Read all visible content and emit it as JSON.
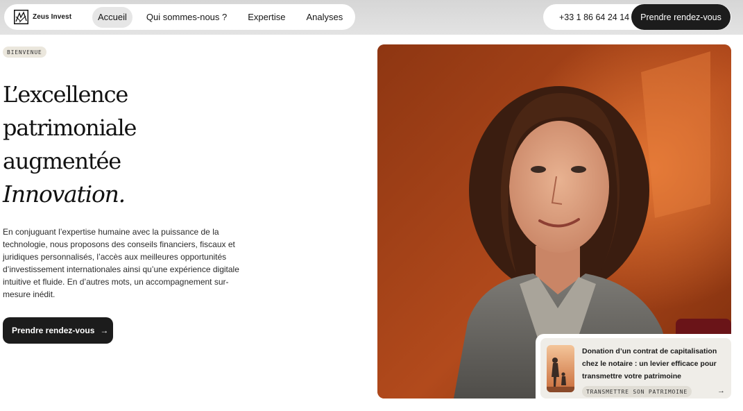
{
  "header": {
    "brand": "Zeus Invest",
    "logo_icon": "zeus-logo-icon",
    "nav": [
      {
        "label": "Accueil",
        "active": true
      },
      {
        "label": "Qui sommes-nous ?",
        "active": false
      },
      {
        "label": "Expertise",
        "active": false
      },
      {
        "label": "Analyses",
        "active": false
      }
    ],
    "phone": "+33 1 86 64 24 14",
    "cta": "Prendre rendez-vous"
  },
  "hero": {
    "badge": "BIENVENUE",
    "headline": [
      "L’excellence",
      "patrimoniale",
      "augmentée"
    ],
    "headline_italic": "Innovation.",
    "intro": "En conjuguant l’expertise humaine avec la puissance de la technologie, nous proposons des conseils financiers, fiscaux et juridiques personnalisés, l’accès aux meilleures opportunités d’investissement internationales ainsi qu’une expérience digitale intuitive et fluide. En d’autres mots, un accompagnement sur-mesure inédit.",
    "cta": "Prendre rendez-vous",
    "cta_icon": "arrow-right-icon"
  },
  "article_card": {
    "title": "Donation d’un contrat de capitalisation chez le notaire : un levier efficace pour transmettre votre patrimoine",
    "tag": "TRANSMETTRE SON PATRIMOINE",
    "icon": "arrow-right-icon"
  },
  "colors": {
    "dark": "#1c1c1c",
    "badge_bg": "#ebe7dd",
    "photo_bg": "#a8441b"
  }
}
